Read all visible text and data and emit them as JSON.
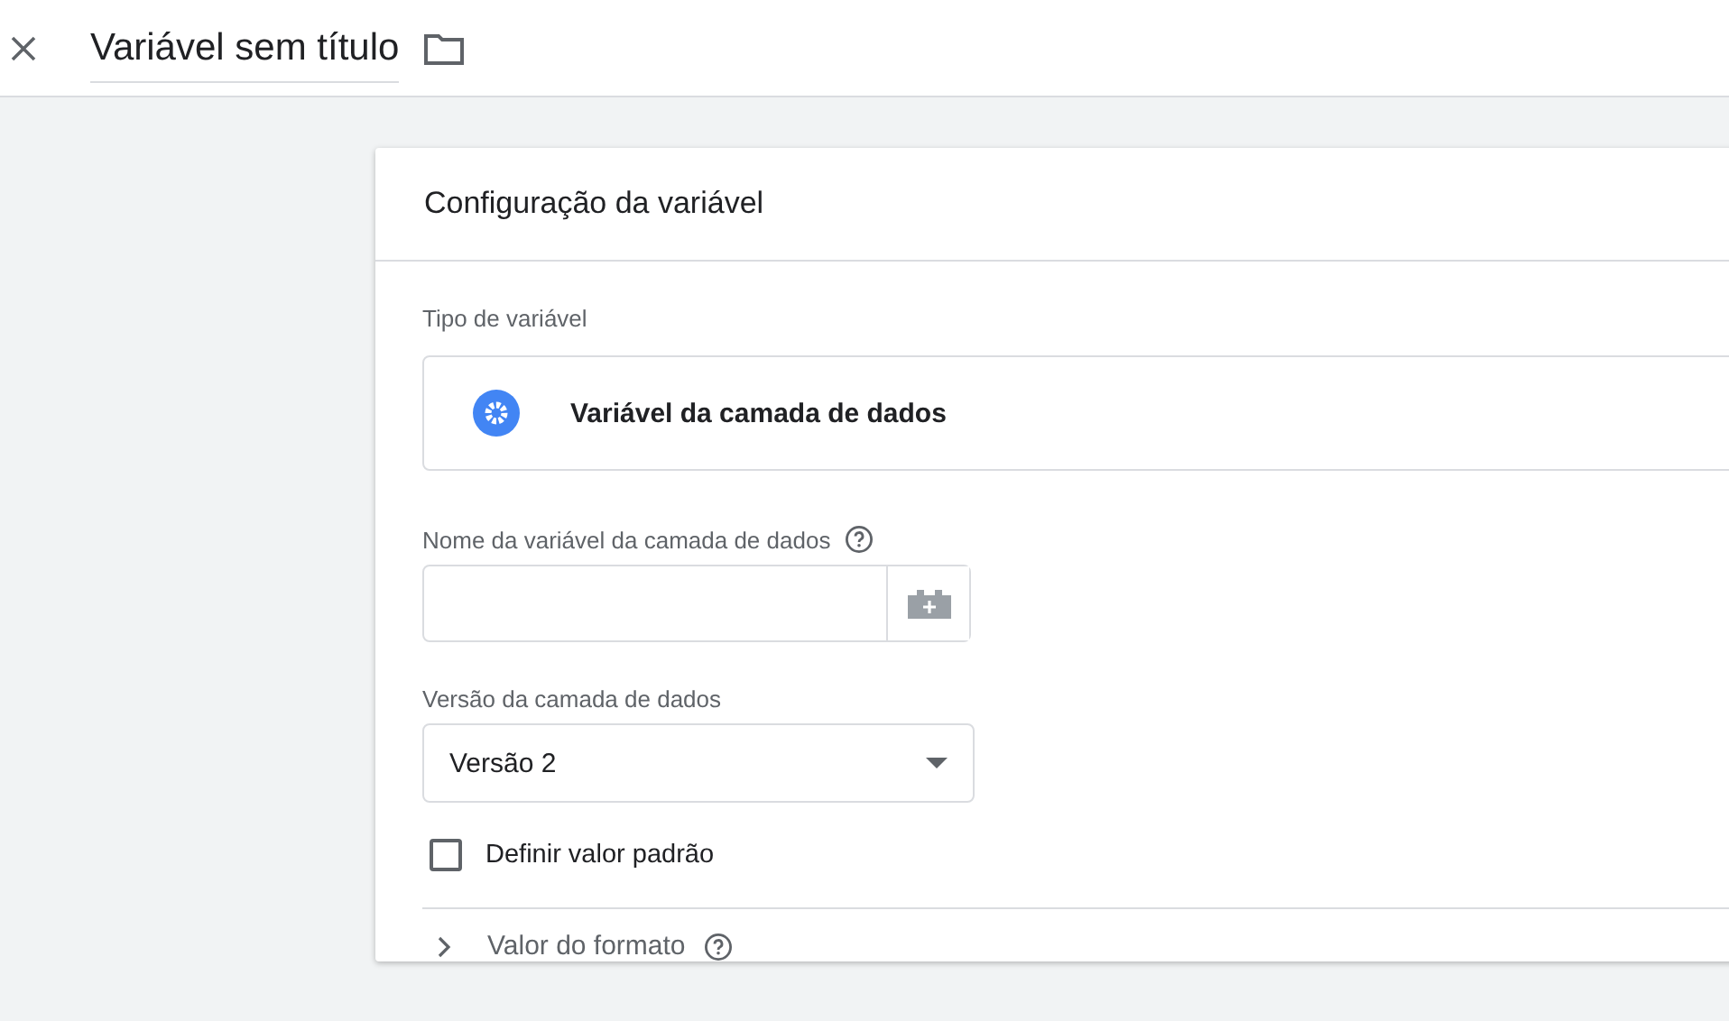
{
  "header": {
    "title": "Variável sem título"
  },
  "card": {
    "title": "Configuração da variável",
    "type_label": "Tipo de variável",
    "type_value": "Variável da camada de dados",
    "name_field": {
      "label": "Nome da variável da camada de dados"
    },
    "version_field": {
      "label": "Versão da camada de dados",
      "value": "Versão 2"
    },
    "default_checkbox": {
      "label": "Definir valor padrão",
      "checked": false
    },
    "format_section": {
      "label": "Valor do formato",
      "expanded": false
    }
  }
}
